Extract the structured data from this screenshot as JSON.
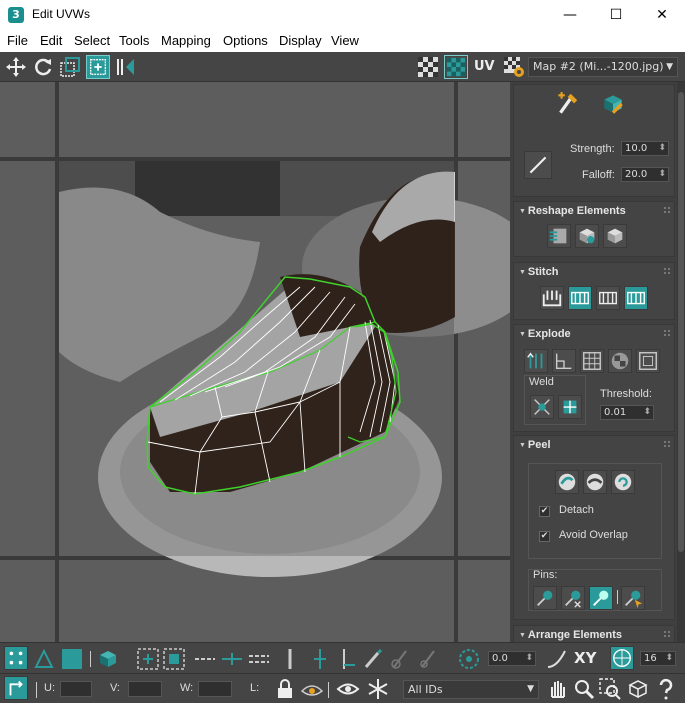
{
  "window": {
    "title": "Edit UVWs",
    "app_icon_text": "3",
    "minimize": "—",
    "maximize": "☐",
    "close": "✕"
  },
  "menu": [
    "File",
    "Edit",
    "Select",
    "Tools",
    "Mapping",
    "Options",
    "Display",
    "View"
  ],
  "toolbar": {
    "uv_label": "UV",
    "map_select": "Map #2 (Mi...-1200.jpg)"
  },
  "panel": {
    "strength_label": "Strength:",
    "strength_value": "10.0",
    "falloff_label": "Falloff:",
    "falloff_value": "20.0",
    "reshape_title": "Reshape Elements",
    "stitch_title": "Stitch",
    "explode_title": "Explode",
    "weld_label": "Weld",
    "threshold_label": "Threshold:",
    "threshold_value": "0.01",
    "peel_title": "Peel",
    "detach_label": "Detach",
    "detach_checked": true,
    "avoid_overlap_label": "Avoid Overlap",
    "avoid_overlap_checked": true,
    "pins_label": "Pins:",
    "arrange_title": "Arrange Elements"
  },
  "bottom": {
    "angle_value": "0.0",
    "xy_label": "XY",
    "grid_value": "16",
    "u_label": "U:",
    "v_label": "V:",
    "w_label": "W:",
    "l_label": "L:",
    "ids_select": "All IDs"
  },
  "colors": {
    "accent_teal": "#2b9a9a",
    "uv_wire_green": "#3fd12c",
    "uv_wire_white": "#ffffff"
  }
}
